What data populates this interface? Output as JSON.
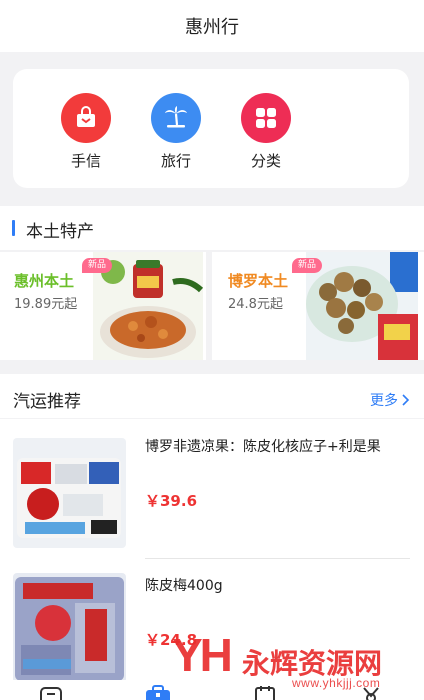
{
  "header": {
    "title": "惠州行"
  },
  "quick_entries": [
    {
      "label": "手信",
      "icon": "gift-bag-icon",
      "color": "#f23b3b"
    },
    {
      "label": "旅行",
      "icon": "palm-tree-icon",
      "color": "#3d8cf2"
    },
    {
      "label": "分类",
      "icon": "grid-category-icon",
      "color": "#ee2d55"
    }
  ],
  "local_specialties": {
    "title": "本土特产",
    "accent_color": "#2f7df6",
    "items": [
      {
        "name": "惠州本土",
        "price": "19.89元起",
        "badge": "新品",
        "name_color": "#6bbf2a"
      },
      {
        "name": "博罗本土",
        "price": "24.8元起",
        "badge": "新品",
        "name_color": "#f08a22"
      }
    ]
  },
  "recommend": {
    "title": "汽运推荐",
    "more_label": "更多",
    "products": [
      {
        "title": "博罗非遗凉果：陈皮化核应子+利是果",
        "price": "￥39.6"
      },
      {
        "title": "陈皮梅400g",
        "price": "￥24.8"
      }
    ]
  },
  "watermark": {
    "logo": "YH",
    "name": "永辉资源网",
    "url": "www.yhkjjj.com"
  }
}
